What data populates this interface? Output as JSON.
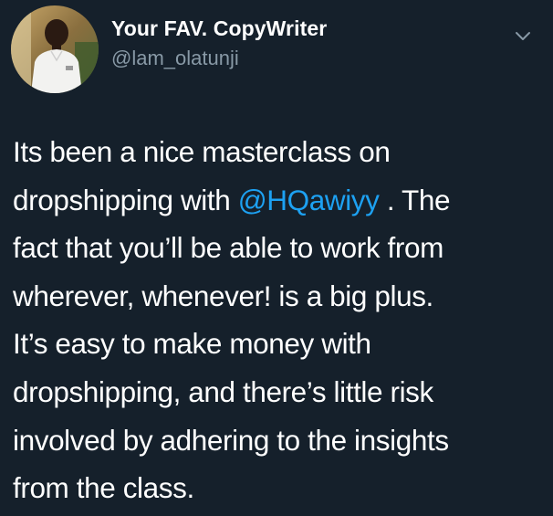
{
  "tweet": {
    "author": {
      "display_name": "Your FAV. CopyWriter",
      "handle": "@lam_olatunji",
      "avatar_icon": "profile-photo"
    },
    "menu_icon": "chevron-down-icon",
    "body": {
      "line1": "Its been a nice masterclass on",
      "line2_before": "dropshipping with ",
      "mention": "@HQawiyy",
      "line2_after": " . The",
      "line3": "fact that you’ll be able to work from",
      "line4": "wherever, whenever! is a big plus.",
      "line5": "It’s easy to make money with",
      "line6": "dropshipping, and there’s little risk",
      "line7": "involved by adhering to the insights",
      "line8": "from the class."
    }
  },
  "colors": {
    "background": "#15202b",
    "text": "#ffffff",
    "secondary_text": "#8899a6",
    "mention": "#1da1f2"
  }
}
